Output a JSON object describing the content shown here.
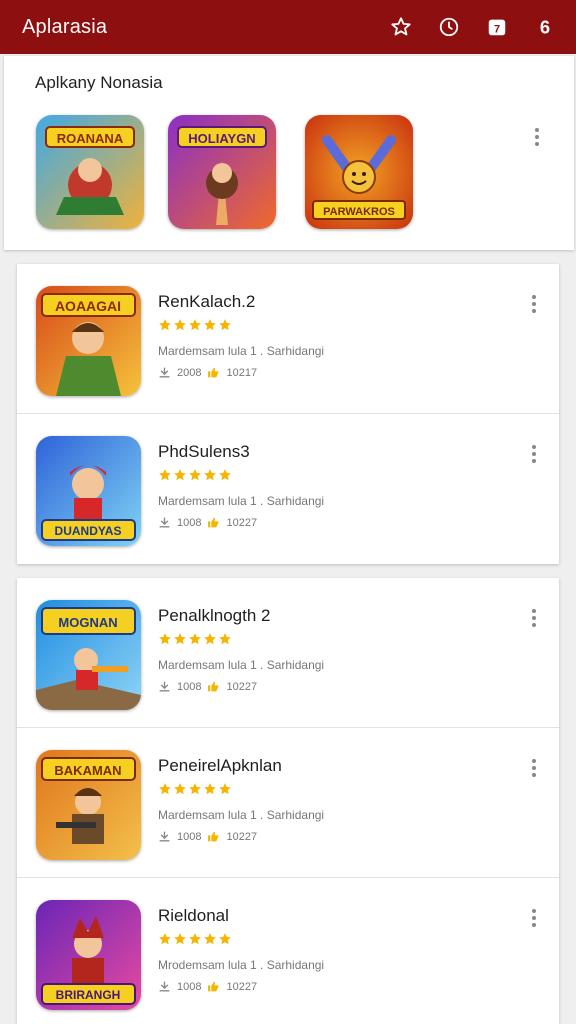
{
  "appbar": {
    "title": "Aplarasia",
    "icons": [
      "star-outline-icon",
      "clock-icon",
      "calendar-icon",
      "notification-badge-icon"
    ],
    "badge": "6",
    "calendar_label": "7",
    "color": "#8e0f0f"
  },
  "featured": {
    "title": "Aplkany Nonasia",
    "items": [
      {
        "label": "ROANANA",
        "colors": [
          "#3fa9e6",
          "#f0b23a"
        ]
      },
      {
        "label": "HOLIAYGN",
        "colors": [
          "#8a2fc7",
          "#f06a2a"
        ]
      },
      {
        "label": "PARWAKROS",
        "colors": [
          "#f2a324",
          "#c9310f"
        ]
      }
    ]
  },
  "cards": [
    {
      "rows": [
        {
          "name": "RenKalach.2",
          "desc": "Mardemsam lula 1 . Sarhidangi",
          "stat1": "2008",
          "stat2": "10217",
          "rating": 5,
          "icon_label": "AOAAGAI",
          "colors": [
            "#d84a1a",
            "#f5c33b"
          ]
        },
        {
          "name": "PhdSulens3",
          "desc": "Mardemsam lula 1 . Sarhidangi",
          "stat1": "1008",
          "stat2": "10227",
          "rating": 5,
          "icon_label": "DUANDYAS",
          "colors": [
            "#2f63d8",
            "#7fd3f5"
          ]
        }
      ]
    },
    {
      "rows": [
        {
          "name": "Penalklnogth 2",
          "desc": "Mardemsam lula 1 . Sarhidangi",
          "stat1": "1008",
          "stat2": "10227",
          "rating": 5,
          "icon_label": "MOGNAN",
          "colors": [
            "#1f8de0",
            "#8fd4f7"
          ]
        },
        {
          "name": "PeneirelApknlan",
          "desc": "Mardemsam lula 1 . Sarhidangi",
          "stat1": "1008",
          "stat2": "10227",
          "rating": 5,
          "icon_label": "BAKAMAN",
          "colors": [
            "#e0761d",
            "#f3c04a"
          ]
        },
        {
          "name": "Rieldonal",
          "desc": "Mrodemsam lula 1 . Sarhidangi",
          "stat1": "1008",
          "stat2": "10227",
          "rating": 5,
          "icon_label": "BRIRANGH",
          "colors": [
            "#6a25b6",
            "#e64aa1"
          ]
        }
      ]
    }
  ]
}
